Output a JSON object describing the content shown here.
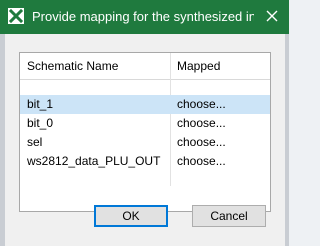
{
  "window": {
    "title": "Provide mapping for the synthesized in...",
    "icon": "app-x-icon",
    "close_icon": "close-icon",
    "accent_color": "#1f7a3e"
  },
  "table": {
    "columns": [
      "Schematic Name",
      "Mapped"
    ],
    "rows": [
      {
        "name": "bit_1",
        "mapped": "choose...",
        "selected": true
      },
      {
        "name": "bit_0",
        "mapped": "choose...",
        "selected": false
      },
      {
        "name": "sel",
        "mapped": "choose...",
        "selected": false
      },
      {
        "name": "ws2812_data_PLU_OUT",
        "mapped": "choose...",
        "selected": false
      }
    ]
  },
  "buttons": {
    "ok": "OK",
    "cancel": "Cancel"
  }
}
